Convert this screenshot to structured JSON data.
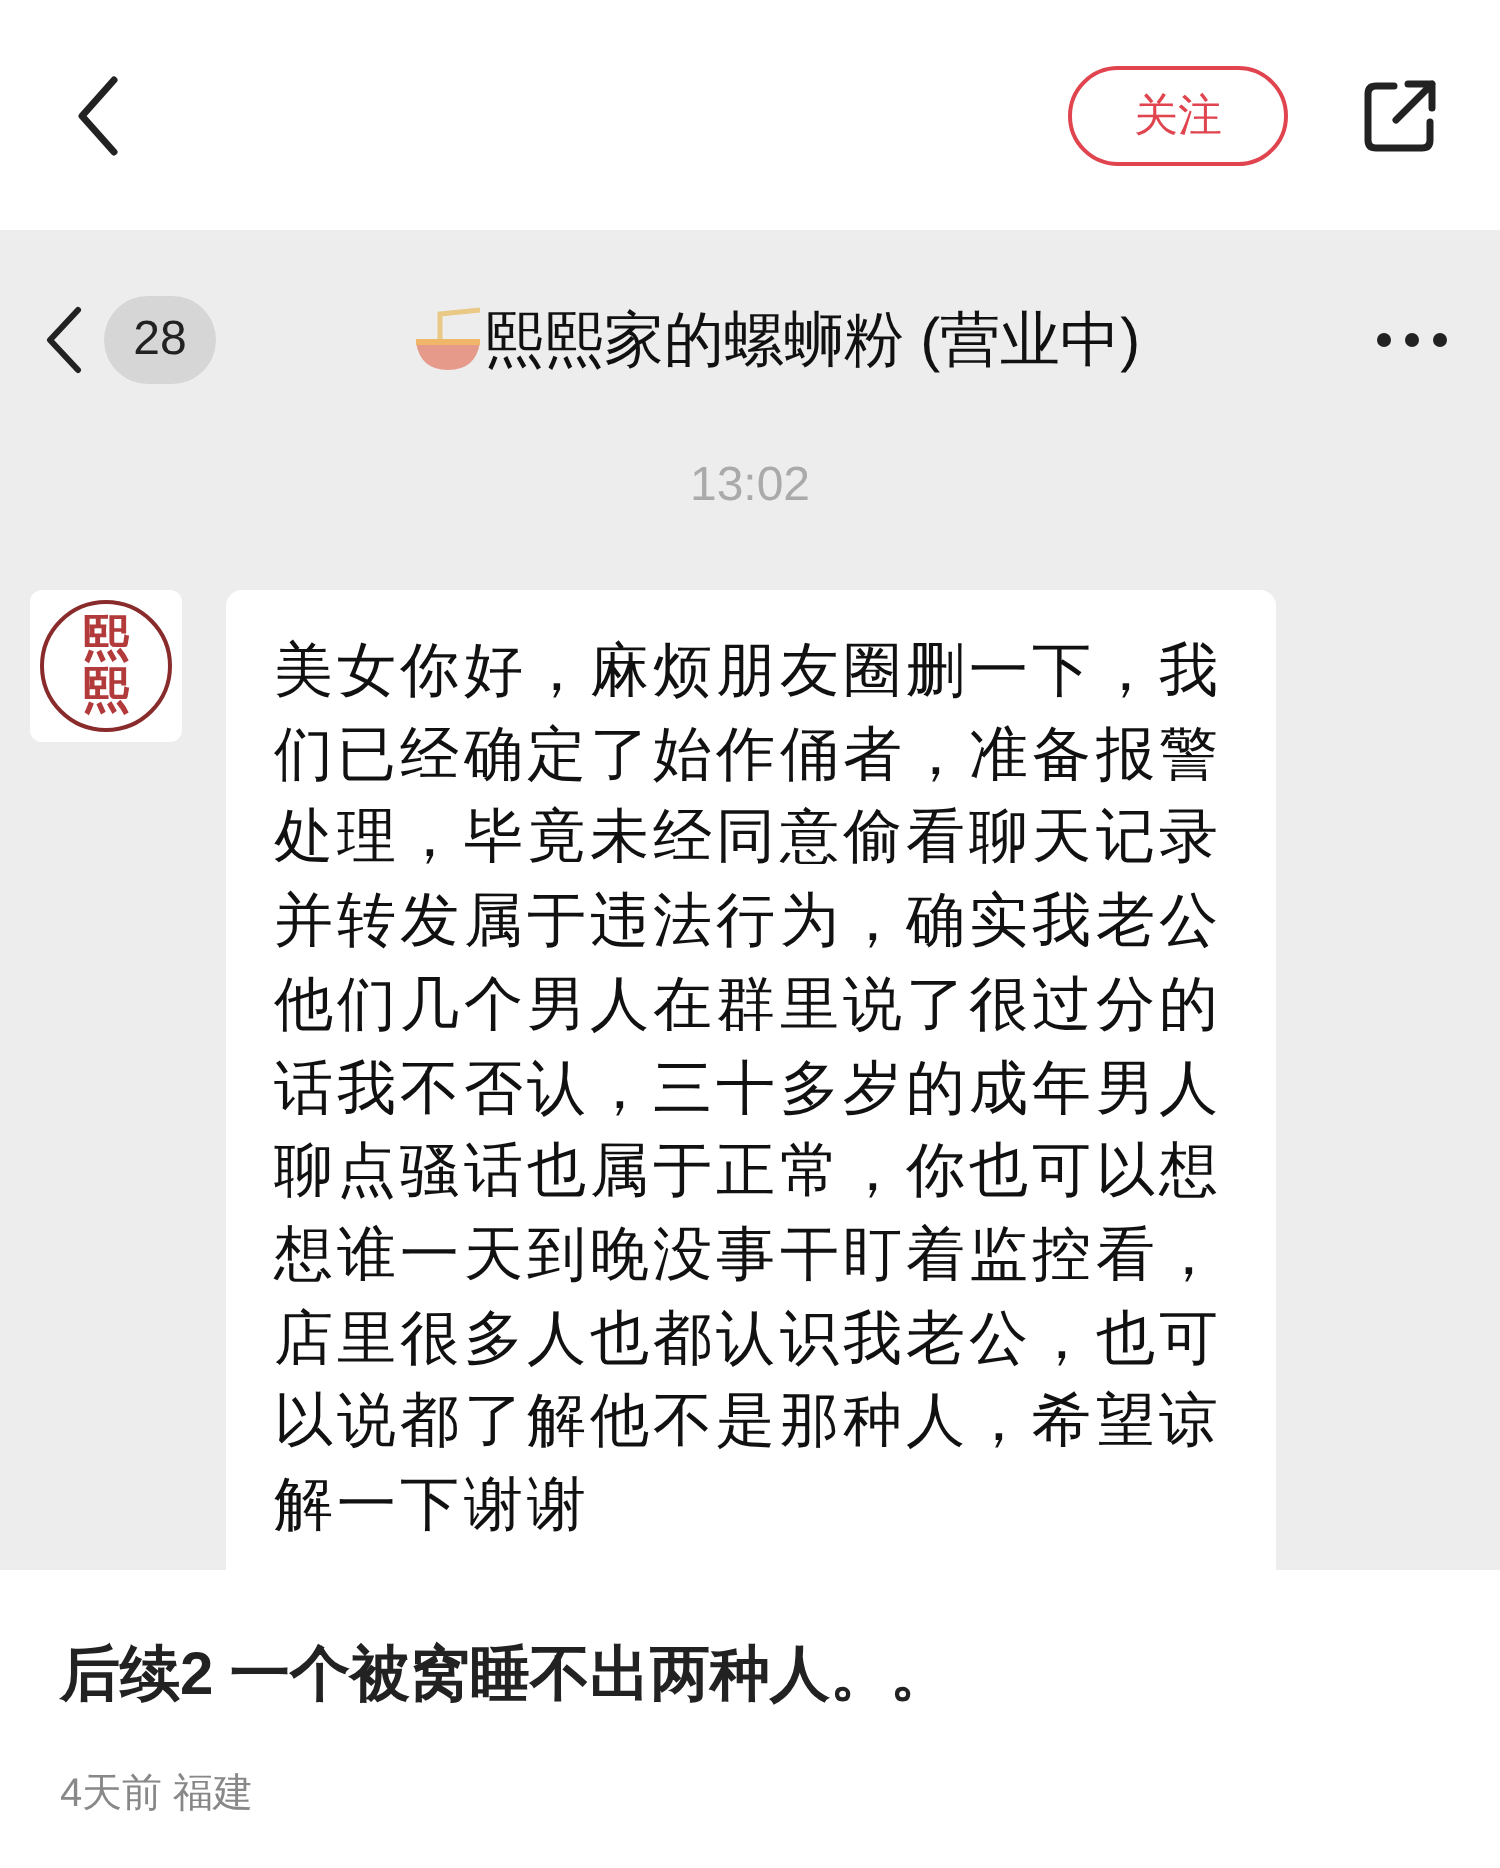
{
  "top_bar": {
    "follow_button": "关注"
  },
  "chat": {
    "unread_count": "28",
    "title": "熙熙家的螺蛳粉 (营业中)",
    "time": "13:02",
    "avatar_text": "熙熙",
    "message": "美女你好，麻烦朋友圈删一下，我们已经确定了始作俑者，准备报警处理，毕竟未经同意偷看聊天记录并转发属于违法行为，确实我老公他们几个男人在群里说了很过分的话我不否认，三十多岁的成年男人聊点骚话也属于正常，你也可以想想谁一天到晚没事干盯着监控看，店里很多人也都认识我老公，也可以说都了解他不是那种人，希望谅解一下谢谢"
  },
  "post": {
    "title": "后续2 一个被窝睡不出两种人。。",
    "meta": "4天前 福建"
  }
}
